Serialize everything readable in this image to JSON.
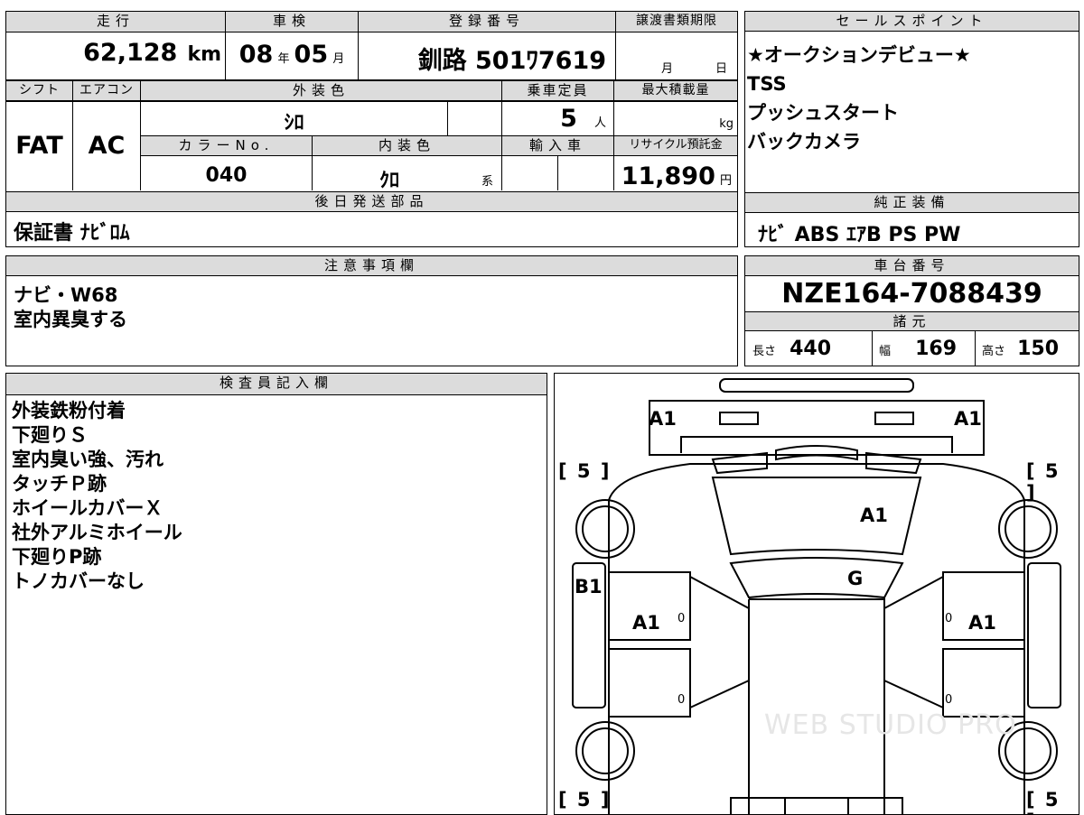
{
  "top_info": {
    "headers": {
      "mileage": "走行",
      "shaken": "車検",
      "registration": "登録番号",
      "transfer_deadline": "譲渡書類期限"
    },
    "mileage_value": "62,128",
    "mileage_unit": "km",
    "shaken_year": "08",
    "shaken_year_unit": "年",
    "shaken_month": "05",
    "shaken_month_unit": "月",
    "registration_number": "釧路 501ﾜ7619",
    "deadline_month_unit": "月",
    "deadline_day_unit": "日"
  },
  "spec_table": {
    "shift_label": "シフト",
    "aircon_label": "エアコン",
    "exterior_color_label": "外装色",
    "capacity_label": "乗車定員",
    "max_load_label": "最大積載量",
    "shift_value": "FAT",
    "aircon_value": "AC",
    "exterior_color_value": "ｼﾛ",
    "capacity_value": "5",
    "capacity_unit": "人",
    "max_load_unit": "kg",
    "color_no_label": "カラーNo.",
    "interior_color_label": "内装色",
    "import_label": "輸入車",
    "recycle_label": "リサイクル預託金",
    "color_no_value": "040",
    "interior_color_value": "ｸﾛ",
    "interior_color_suffix": "系",
    "recycle_value": "11,890",
    "recycle_unit": "円",
    "later_parts_label": "後日発送部品",
    "later_parts_value": "保証書 ﾅﾋﾞﾛﾑ"
  },
  "sales_points": {
    "label": "セールスポイント",
    "lines": [
      "★オークションデビュー★",
      "TSS",
      "プッシュスタート",
      "バックカメラ"
    ]
  },
  "genuine_equipment": {
    "label": "純正装備",
    "value": "ﾅﾋﾞ ABS ｴｱB PS PW"
  },
  "notes": {
    "label": "注意事項欄",
    "lines": [
      "ナビ・W68",
      "室内異臭する"
    ]
  },
  "chassis": {
    "label": "車台番号",
    "value": "NZE164-7088439",
    "dims_label": "諸元",
    "length_label": "長さ",
    "length_value": "440",
    "width_label": "幅",
    "width_value": "169",
    "height_label": "高さ",
    "height_value": "150"
  },
  "inspector": {
    "label": "検査員記入欄",
    "lines": [
      "外装鉄粉付着",
      "下廻りＳ",
      "室内臭い強、汚れ",
      "タッチＰ跡",
      "ホイールカバーＸ",
      "社外アルミホイール",
      "下廻りP跡",
      "トノカバーなし"
    ]
  },
  "diagram": {
    "marks": {
      "front_left": "A1",
      "front_right": "A1",
      "hood": "A1",
      "windshield": "G",
      "left_side": "B1",
      "left_front_door": "A1",
      "right_front_door": "A1"
    },
    "tire_tread": "5",
    "bracket_open": "[",
    "bracket_close": "]",
    "door_zero": "0",
    "watermark": "WEB STUDIO PRO"
  }
}
